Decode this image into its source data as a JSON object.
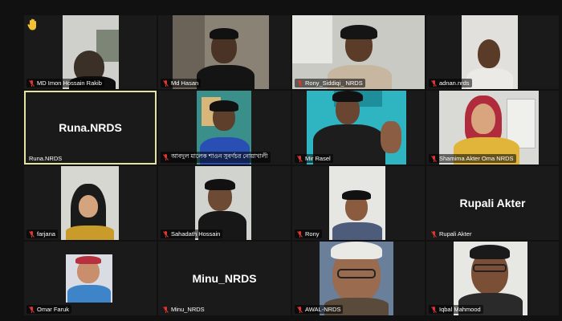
{
  "meeting": {
    "participants": [
      {
        "name": "MD Imon Hossain Rakib"
      },
      {
        "name": "Md Hasan"
      },
      {
        "name": "Rony_Siddiqi_ NRDS"
      },
      {
        "name": "adnan.nrds"
      },
      {
        "name": "Runa.NRDS",
        "display_name": "Runa.NRDS"
      },
      {
        "name": "আবদুল মালেক শাওন সুবর্ণচর নোয়াখালী"
      },
      {
        "name": "Mir Rasel"
      },
      {
        "name": "Shamima Akter Oma NRDS"
      },
      {
        "name": "farjana"
      },
      {
        "name": "Sahadath Hossain"
      },
      {
        "name": "Rony"
      },
      {
        "name": "Rupali Akter",
        "display_name": "Rupali Akter"
      },
      {
        "name": "Omar Faruk"
      },
      {
        "name": "Minu_NRDS",
        "display_name": "Minu_NRDS"
      },
      {
        "name": "AWAL-NRDS"
      },
      {
        "name": "Iqbal Mahmood"
      }
    ]
  },
  "icons": {
    "muted_mic": "mic-muted-icon",
    "raise_hand": "raise-hand-icon"
  },
  "colors": {
    "background": "#111111",
    "tile": "#1a1a1a",
    "active_border": "#e6e3a0",
    "muted_mic": "#e0362f",
    "hand": "#f2c233"
  }
}
